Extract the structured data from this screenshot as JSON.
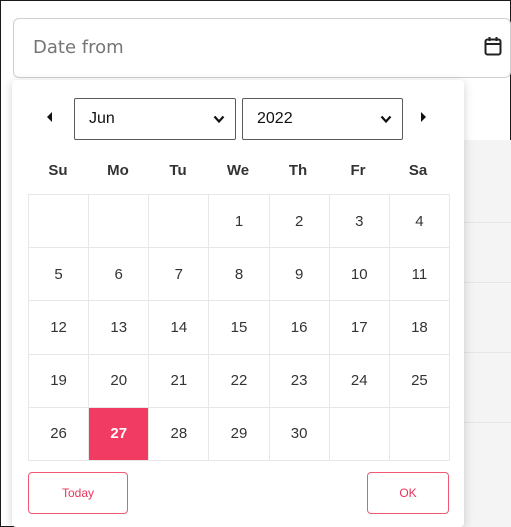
{
  "date_input": {
    "placeholder": "Date from",
    "icon": "calendar-icon"
  },
  "header": {
    "prev_icon": "triangle-left-icon",
    "next_icon": "triangle-right-icon",
    "month_selected": "Jun",
    "year_selected": "2022"
  },
  "weekdays": [
    "Su",
    "Mo",
    "Tu",
    "We",
    "Th",
    "Fr",
    "Sa"
  ],
  "weeks": [
    [
      "",
      "",
      "",
      "1",
      "2",
      "3",
      "4"
    ],
    [
      "5",
      "6",
      "7",
      "8",
      "9",
      "10",
      "11"
    ],
    [
      "12",
      "13",
      "14",
      "15",
      "16",
      "17",
      "18"
    ],
    [
      "19",
      "20",
      "21",
      "22",
      "23",
      "24",
      "25"
    ],
    [
      "26",
      "27",
      "28",
      "29",
      "30",
      "",
      ""
    ]
  ],
  "selected_day": "27",
  "accent_color": "#f23b63",
  "footer": {
    "today_label": "Today",
    "ok_label": "OK"
  }
}
